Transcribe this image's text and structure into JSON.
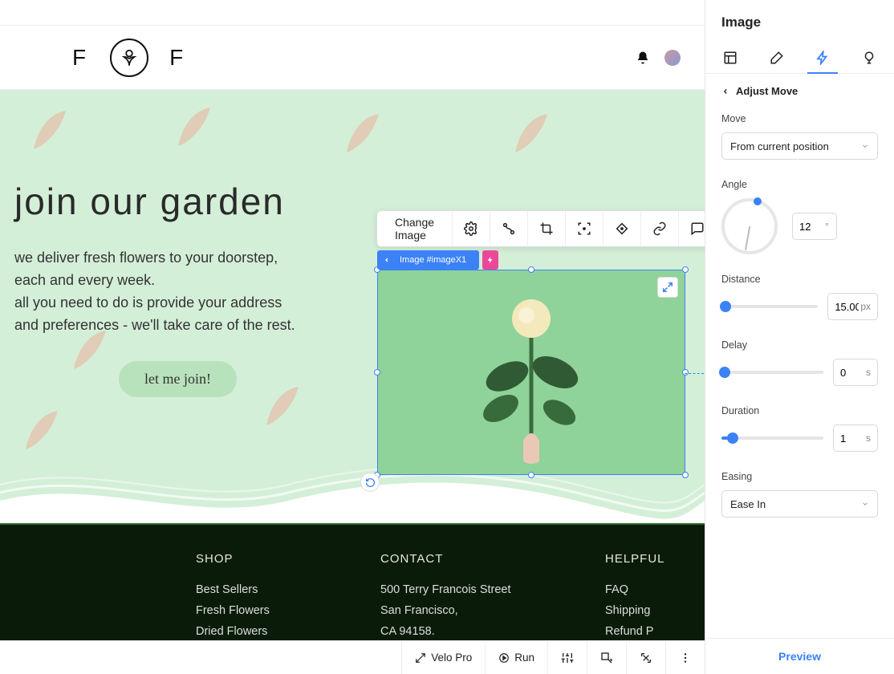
{
  "panel": {
    "title": "Image",
    "back_label": "Adjust Move",
    "move": {
      "label": "Move",
      "value": "From current position"
    },
    "angle": {
      "label": "Angle",
      "value": "12",
      "unit": "°"
    },
    "distance": {
      "label": "Distance",
      "value": "15.00",
      "unit": "px",
      "pct": 4
    },
    "delay": {
      "label": "Delay",
      "value": "0",
      "unit": "s",
      "pct": 3
    },
    "duration": {
      "label": "Duration",
      "value": "1",
      "unit": "s",
      "pct": 11
    },
    "easing": {
      "label": "Easing",
      "value": "Ease In"
    },
    "preview": "Preview"
  },
  "toolbar": {
    "change_image": "Change Image"
  },
  "selection": {
    "badge": "Image #imageX1"
  },
  "header": {
    "logo_left": "F",
    "logo_right": "F"
  },
  "hero": {
    "title": "join our garden",
    "line1": "we deliver fresh flowers to your doorstep,",
    "line2": "each and every week.",
    "line3": "all you need to do is provide your address",
    "line4": "and preferences - we'll take care of the rest.",
    "cta": "let me join!"
  },
  "footer": {
    "shop": {
      "head": "SHOP",
      "items": [
        "Best Sellers",
        "Fresh Flowers",
        "Dried Flowers"
      ]
    },
    "contact": {
      "head": "CONTACT",
      "line1": "500 Terry Francois Street",
      "line2": "San Francisco,",
      "line3": "CA 94158."
    },
    "help": {
      "head": "HELPFUL",
      "items": [
        "FAQ",
        "Shipping",
        "Refund P"
      ]
    }
  },
  "bottombar": {
    "velo": "Velo Pro",
    "run": "Run"
  }
}
